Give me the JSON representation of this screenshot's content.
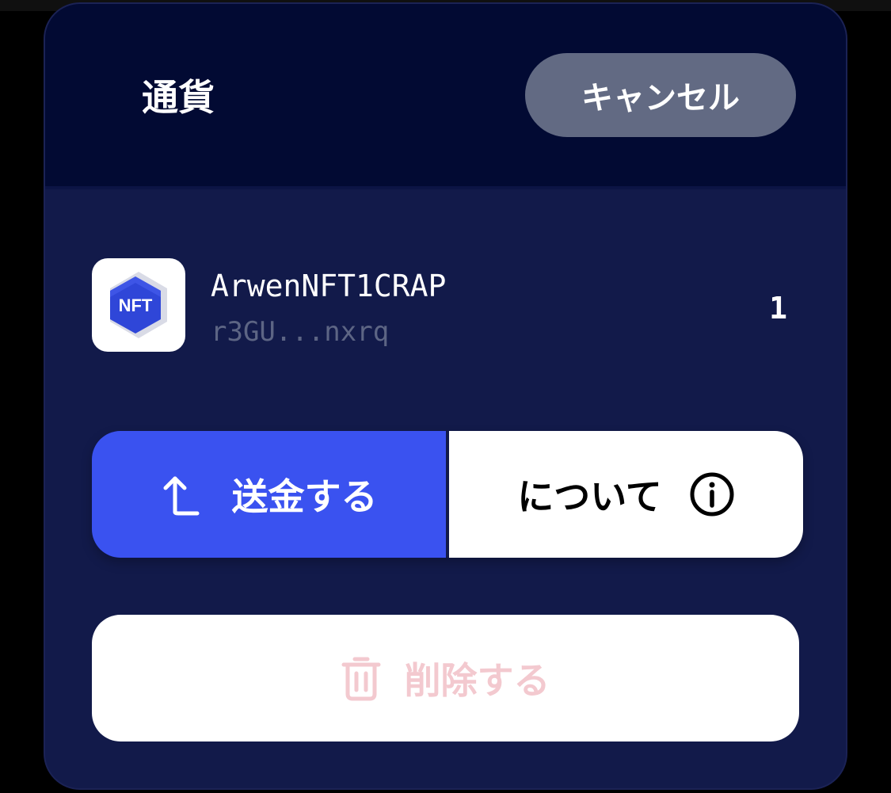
{
  "header": {
    "title": "通貨",
    "cancel_label": "キャンセル"
  },
  "token": {
    "icon_label": "NFT",
    "name": "ArwenNFT1CRAP",
    "address": "r3GU...nxrq",
    "amount": "1"
  },
  "actions": {
    "send_label": "送金する",
    "about_label": "について",
    "delete_label": "削除する"
  },
  "icons": {
    "send": "arrow-up-turn-icon",
    "about": "info-circle-icon",
    "delete": "trash-icon",
    "token": "nft-hexagon-icon"
  },
  "colors": {
    "sheet_background": "#121a4a",
    "header_background": "#020a33",
    "send_accent": "#3a52f0",
    "cancel_button": "#626a83",
    "delete_text": "#f3c9cf",
    "address_text": "#5d6584"
  }
}
